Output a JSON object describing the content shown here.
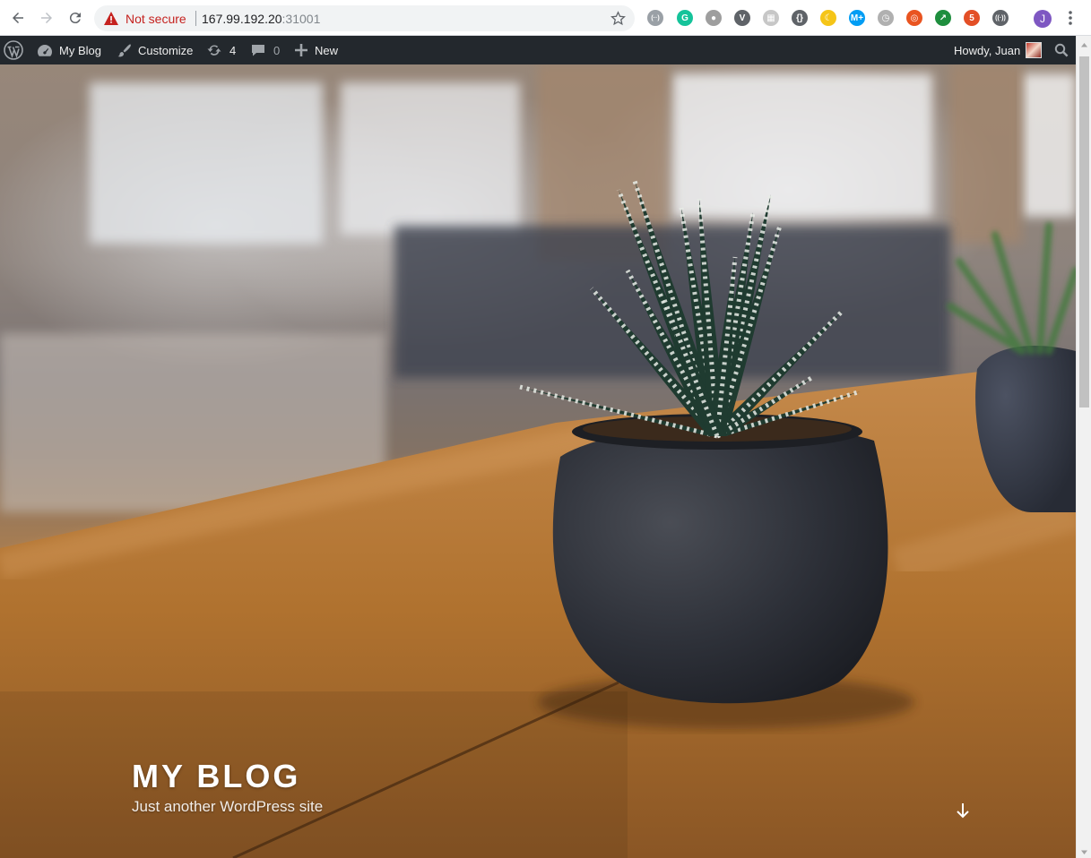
{
  "browser": {
    "security_label": "Not secure",
    "url_host": "167.99.192.20",
    "url_port": ":31001",
    "profile_initial": "J",
    "extensions": [
      {
        "name": "readermode-extension-icon",
        "color": "#9aa0a6",
        "glyph": "(··)"
      },
      {
        "name": "grammarly-extension-icon",
        "color": "#15c39a",
        "glyph": "G"
      },
      {
        "name": "circle-extension-icon",
        "color": "#9e9e9e",
        "glyph": "●"
      },
      {
        "name": "vimeo-extension-icon",
        "color": "#5f6368",
        "glyph": "V"
      },
      {
        "name": "grid-extension-icon",
        "color": "#c7c7c7",
        "glyph": "▦"
      },
      {
        "name": "code-extension-icon",
        "color": "#5f6368",
        "glyph": "{}"
      },
      {
        "name": "moon-extension-icon",
        "color": "#f5c518",
        "glyph": "☾"
      },
      {
        "name": "movistar-extension-icon",
        "color": "#019df4",
        "glyph": "M+"
      },
      {
        "name": "clock-extension-icon",
        "color": "#b0b0b0",
        "glyph": "◷"
      },
      {
        "name": "ubuntu-extension-icon",
        "color": "#e95420",
        "glyph": "◎"
      },
      {
        "name": "arrow-extension-icon",
        "color": "#1e8e3e",
        "glyph": "↗"
      },
      {
        "name": "html5-extension-icon",
        "color": "#e34f26",
        "glyph": "5"
      },
      {
        "name": "radio-extension-icon",
        "color": "#5f6368",
        "glyph": "((·))"
      }
    ]
  },
  "adminbar": {
    "site_name": "My Blog",
    "customize": "Customize",
    "updates_count": "4",
    "comments_count": "0",
    "new_label": "New",
    "howdy": "Howdy, Juan"
  },
  "hero": {
    "site_title": "MY BLOG",
    "site_description": "Just another WordPress site"
  }
}
